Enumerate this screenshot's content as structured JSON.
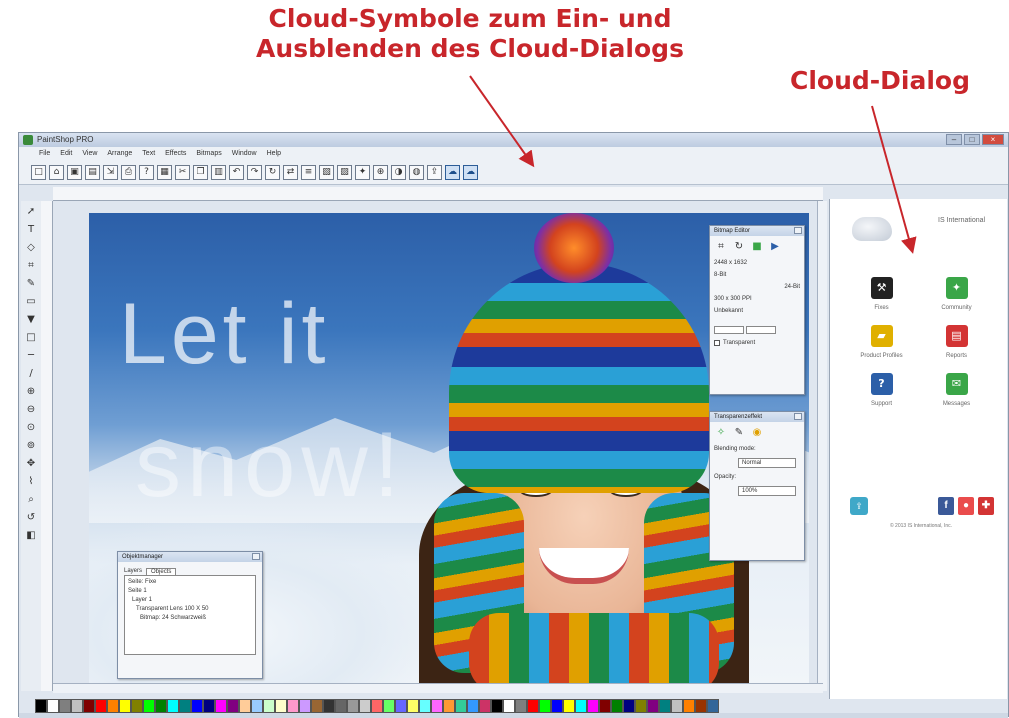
{
  "callouts": {
    "cloud_symbols_line1": "Cloud-Symbole zum Ein- und",
    "cloud_symbols_line2": "Ausblenden des Cloud-Dialogs",
    "cloud_dialog": "Cloud-Dialog"
  },
  "colors": {
    "callout_red": "#c8262b",
    "window_frame": "#dfe6ef",
    "close_button": "#d24c3f"
  },
  "window": {
    "title": "PaintShop PRO",
    "controls": [
      "–",
      "□",
      "×"
    ]
  },
  "menu": [
    "File",
    "Edit",
    "View",
    "Arrange",
    "Text",
    "Effects",
    "Bitmaps",
    "Window",
    "Help"
  ],
  "toolbar": {
    "buttons": [
      "new-icon",
      "open-icon",
      "save-icon",
      "scan-icon",
      "import-icon",
      "print-icon",
      "help-icon",
      "grid-icon",
      "cut-icon",
      "copy-icon",
      "paste-icon",
      "undo-icon",
      "redo-icon",
      "rotate-icon",
      "flip-icon",
      "align-icon",
      "group-icon",
      "ungroup-icon",
      "wizard-icon",
      "zoom-icon",
      "color-icon",
      "globe-icon",
      "cloud-upload-icon",
      "cloud-toggle-icon",
      "cloud-dialog-icon"
    ]
  },
  "tools": [
    "pick-icon",
    "text-icon",
    "shape-icon",
    "crop-icon",
    "pen-icon",
    "eraser-icon",
    "fill-icon",
    "rectangle-icon",
    "line-icon",
    "brush-icon",
    "zoom-in-icon",
    "zoom-out-icon",
    "zoom-fit-icon",
    "zoom-page-icon",
    "pan-icon",
    "eyedropper-icon",
    "zoom-icon",
    "rotate-icon",
    "color-picker-icon"
  ],
  "canvas": {
    "overlay_line1": "Let it",
    "overlay_line2": "snow!"
  },
  "panels": {
    "bitmap": {
      "title": "Bitmap Editor",
      "lines": [
        "2448 x 1632",
        "8-Bit",
        "24-Bit",
        "300 x 300 PPI",
        "Unbekannt"
      ],
      "checkbox": "Transparent"
    },
    "transparency": {
      "title": "Transparenzeffekt",
      "blending_label": "Blending mode:",
      "blending_value": "Normal",
      "opacity_label": "Opacity:",
      "opacity_value": "100%"
    },
    "object_manager": {
      "title": "Objektmanager",
      "tabs": [
        "Layers",
        "Objects"
      ],
      "items": [
        "Seite: Fixe",
        "Seite 1",
        "Layer 1",
        "Transparent Lens 100 X 50",
        "Bitmap: 24 Schwarzweiß"
      ]
    }
  },
  "cloud": {
    "brand": "IS International",
    "items": [
      {
        "label": "Fixes",
        "icon": "fixes-icon",
        "glyph": "⚒",
        "color": "#222222"
      },
      {
        "label": "Community",
        "icon": "community-icon",
        "glyph": "✦",
        "color": "#3aa648"
      },
      {
        "label": "Product Profiles",
        "icon": "profiles-icon",
        "glyph": "▰",
        "color": "#e0b000"
      },
      {
        "label": "Reports",
        "icon": "reports-icon",
        "glyph": "▤",
        "color": "#d33434"
      },
      {
        "label": "Support",
        "icon": "support-icon",
        "glyph": "?",
        "color": "#2c5fa8"
      },
      {
        "label": "Messages",
        "icon": "messages-icon",
        "glyph": "✉",
        "color": "#3aa648"
      }
    ],
    "footer_copyright": "© 2013 IS International, Inc.",
    "social": [
      {
        "glyph": "f",
        "color": "#3b5998",
        "icon": "facebook-icon"
      },
      {
        "glyph": "●",
        "color": "#ea4c4c",
        "icon": "youtube-icon"
      },
      {
        "glyph": "✚",
        "color": "#d33434",
        "icon": "google-plus-icon"
      }
    ]
  },
  "palette": [
    "#000000",
    "#ffffff",
    "#7f7f7f",
    "#c0c0c0",
    "#800000",
    "#ff0000",
    "#ff8000",
    "#ffff00",
    "#808000",
    "#00ff00",
    "#008000",
    "#00ffff",
    "#008080",
    "#0000ff",
    "#000080",
    "#ff00ff",
    "#800080",
    "#ffcc99",
    "#99ccff",
    "#ccffcc",
    "#ffffcc",
    "#ff99cc",
    "#cc99ff",
    "#996633",
    "#333333",
    "#666666",
    "#999999",
    "#cccccc",
    "#ff6666",
    "#66ff66",
    "#6666ff",
    "#ffff66",
    "#66ffff",
    "#ff66ff",
    "#ff9933",
    "#33cc99",
    "#3399ff",
    "#cc3366",
    "#000000",
    "#ffffff",
    "#7f7f7f",
    "#ff0000",
    "#00ff00",
    "#0000ff",
    "#ffff00",
    "#00ffff",
    "#ff00ff",
    "#800000",
    "#008000",
    "#000080",
    "#808000",
    "#800080",
    "#008080",
    "#c0c0c0",
    "#ff8000",
    "#993300",
    "#336699"
  ]
}
